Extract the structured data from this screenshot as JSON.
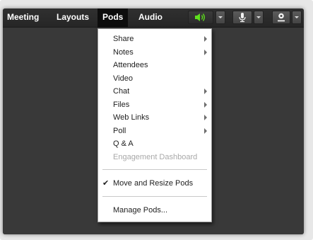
{
  "menubar": {
    "items": [
      {
        "label": "Meeting"
      },
      {
        "label": "Layouts"
      },
      {
        "label": "Pods"
      },
      {
        "label": "Audio"
      }
    ],
    "active": "Pods"
  },
  "toolbar": {
    "speaker_icon": "speaker-icon",
    "speaker_color": "#5ee01c",
    "mic_icon": "microphone-icon",
    "camera_icon": "webcam-icon"
  },
  "pods_menu": {
    "items": [
      {
        "label": "Share",
        "submenu": true,
        "enabled": true
      },
      {
        "label": "Notes",
        "submenu": true,
        "enabled": true
      },
      {
        "label": "Attendees",
        "submenu": false,
        "enabled": true
      },
      {
        "label": "Video",
        "submenu": false,
        "enabled": true
      },
      {
        "label": "Chat",
        "submenu": true,
        "enabled": true
      },
      {
        "label": "Files",
        "submenu": true,
        "enabled": true
      },
      {
        "label": "Web Links",
        "submenu": true,
        "enabled": true
      },
      {
        "label": "Poll",
        "submenu": true,
        "enabled": true
      },
      {
        "label": "Q & A",
        "submenu": false,
        "enabled": true
      },
      {
        "label": "Engagement Dashboard",
        "submenu": false,
        "enabled": false
      }
    ],
    "move_resize": {
      "label": "Move and Resize Pods",
      "checked": true,
      "check_glyph": "✔"
    },
    "manage": {
      "label": "Manage Pods..."
    }
  }
}
